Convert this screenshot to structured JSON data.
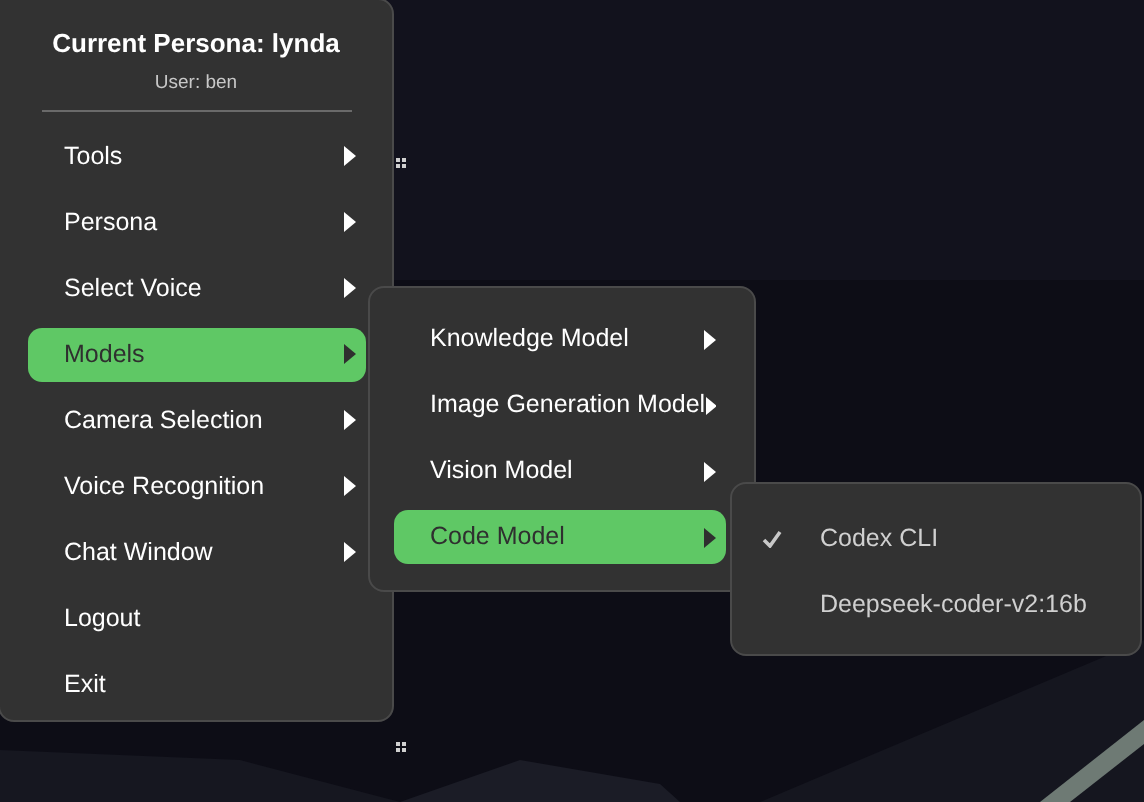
{
  "header": {
    "title": "Current Persona: lynda",
    "subtitle": "User: ben"
  },
  "menu": [
    {
      "label": "Tools",
      "submenu": true,
      "selected": false
    },
    {
      "label": "Persona",
      "submenu": true,
      "selected": false
    },
    {
      "label": "Select Voice",
      "submenu": true,
      "selected": false
    },
    {
      "label": "Models",
      "submenu": true,
      "selected": true
    },
    {
      "label": "Camera Selection",
      "submenu": true,
      "selected": false
    },
    {
      "label": "Voice Recognition",
      "submenu": true,
      "selected": false
    },
    {
      "label": "Chat Window",
      "submenu": true,
      "selected": false
    },
    {
      "label": "Logout",
      "submenu": false,
      "selected": false
    },
    {
      "label": "Exit",
      "submenu": false,
      "selected": false
    }
  ],
  "models_menu": [
    {
      "label": "Knowledge Model",
      "submenu": true,
      "selected": false
    },
    {
      "label": "Image Generation Model",
      "submenu": true,
      "selected": false
    },
    {
      "label": "Vision Model",
      "submenu": true,
      "selected": false
    },
    {
      "label": "Code Model",
      "submenu": true,
      "selected": true
    }
  ],
  "code_model_menu": [
    {
      "label": "Codex CLI",
      "checked": true
    },
    {
      "label": "Deepseek-coder-v2:16b",
      "checked": false
    }
  ]
}
